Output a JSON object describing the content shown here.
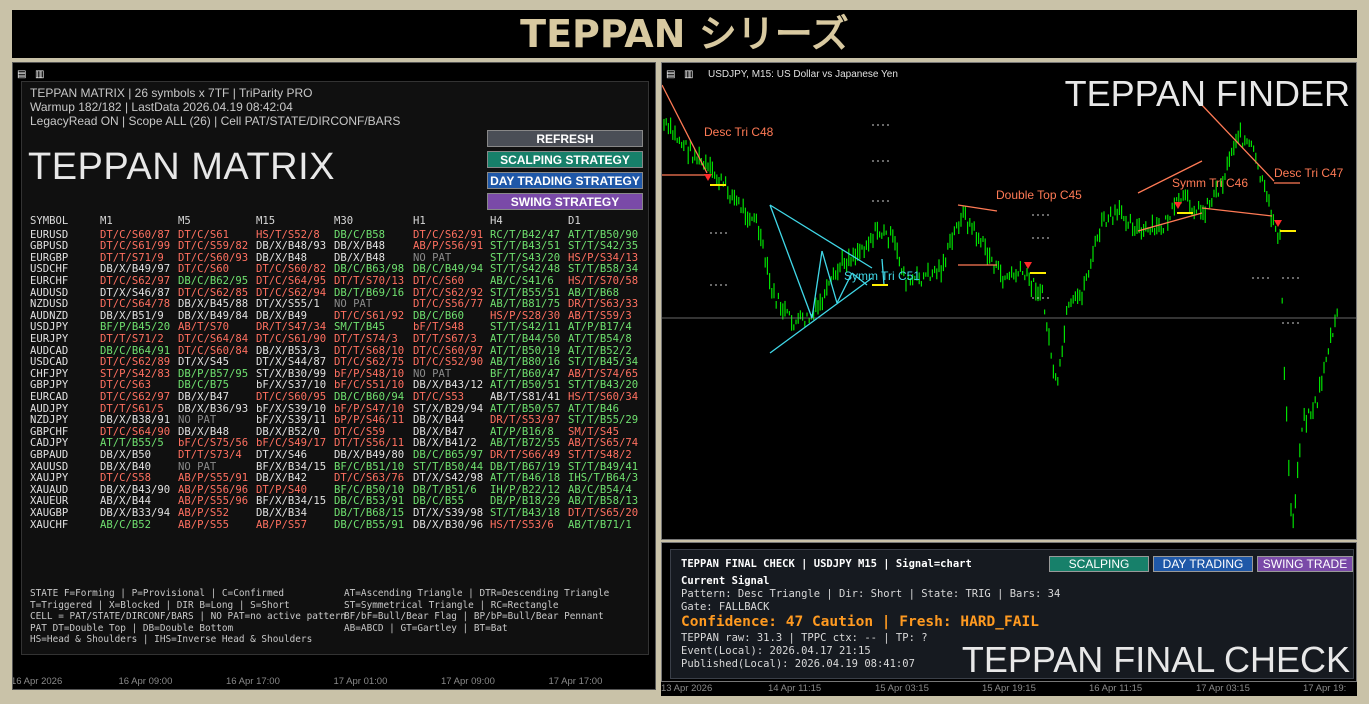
{
  "banner": "TEPPAN シリーズ",
  "matrix": {
    "header_lines": [
      "TEPPAN MATRIX | 26 symbols x 7TF | TriParity PRO",
      "Warmup 182/182 | LastData 2026.04.19 08:42:04",
      "LegacyRead ON | Scope ALL (26) | Cell PAT/STATE/DIRCONF/BARS"
    ],
    "big_title": "TEPPAN MATRIX",
    "buttons": {
      "refresh": "REFRESH",
      "scalping": "SCALPING STRATEGY",
      "day": "DAY TRADING STRATEGY",
      "swing": "SWING STRATEGY"
    },
    "columns": [
      "SYMBOL",
      "M1",
      "M5",
      "M15",
      "M30",
      "H1",
      "H4",
      "D1"
    ],
    "rows": [
      [
        "EURUSD",
        "DT/C/S60/87",
        "DT/C/S61",
        "HS/T/S52/8",
        "DB/C/B58",
        "DT/C/S62/91",
        "RC/T/B42/47",
        "AT/T/B50/90"
      ],
      [
        "GBPUSD",
        "DT/C/S61/99",
        "DT/C/S59/82",
        "DB/X/B48/93",
        "DB/X/B48",
        "AB/P/S56/91",
        "ST/T/B43/51",
        "ST/T/S42/35"
      ],
      [
        "EURGBP",
        "DT/T/S71/9",
        "DT/C/S60/93",
        "DB/X/B48",
        "DB/X/B48",
        "NO PAT",
        "ST/T/S43/20",
        "HS/P/S34/13"
      ],
      [
        "USDCHF",
        "DB/X/B49/97",
        "DT/C/S60",
        "DT/C/S60/82",
        "DB/C/B63/98",
        "DB/C/B49/94",
        "ST/T/S42/48",
        "ST/T/B58/34"
      ],
      [
        "EURCHF",
        "DT/C/S62/97",
        "DB/C/B62/95",
        "DT/C/S64/95",
        "DT/T/S70/13",
        "DT/C/S60",
        "AB/C/S41/6",
        "HS/T/S70/58"
      ],
      [
        "AUDUSD",
        "DT/X/S46/87",
        "DT/C/S62/85",
        "DT/C/S62/94",
        "DB/T/B69/16",
        "DT/C/S62/92",
        "ST/T/B55/51",
        "AB/T/B68"
      ],
      [
        "NZDUSD",
        "DT/C/S64/78",
        "DB/X/B45/88",
        "DT/X/S55/1",
        "NO PAT",
        "DT/C/S56/77",
        "AB/T/B81/75",
        "DR/T/S63/33"
      ],
      [
        "AUDNZD",
        "DB/X/B51/9",
        "DB/X/B49/84",
        "DB/X/B49",
        "DT/C/S61/92",
        "DB/C/B60",
        "HS/P/S28/30",
        "AB/T/S59/3"
      ],
      [
        "USDJPY",
        "BF/P/B45/20",
        "AB/T/S70",
        "DR/T/S47/34",
        "SM/T/B45",
        "bF/T/S48",
        "ST/T/S42/11",
        "AT/P/B17/4"
      ],
      [
        "EURJPY",
        "DT/T/S71/2",
        "DT/C/S64/84",
        "DT/C/S61/90",
        "DT/T/S74/3",
        "DT/T/S67/3",
        "AT/T/B44/50",
        "AT/T/B54/8"
      ],
      [
        "AUDCAD",
        "DB/C/B64/91",
        "DT/C/S60/84",
        "DB/X/B53/3",
        "DT/T/S68/10",
        "DT/C/S60/97",
        "AT/T/B50/19",
        "AT/T/B52/2"
      ],
      [
        "USDCAD",
        "DT/C/S62/89",
        "DT/X/S45",
        "DT/X/S44/87",
        "DT/C/S62/75",
        "DT/C/S52/90",
        "AB/T/B80/16",
        "ST/T/B45/34"
      ],
      [
        "CHFJPY",
        "ST/P/S42/83",
        "DB/P/B57/95",
        "ST/X/B30/99",
        "bF/P/S48/10",
        "NO PAT",
        "BF/T/B60/47",
        "AB/T/S74/65"
      ],
      [
        "GBPJPY",
        "DT/C/S63",
        "DB/C/B75",
        "bF/X/S37/10",
        "bF/C/S51/10",
        "DB/X/B43/12",
        "AT/T/B50/51",
        "ST/T/B43/20"
      ],
      [
        "EURCAD",
        "DT/C/S62/97",
        "DB/X/B47",
        "DT/C/S60/95",
        "DB/C/B60/94",
        "DT/C/S53",
        "AB/T/S81/41",
        "HS/T/S60/34"
      ],
      [
        "AUDJPY",
        "DT/T/S61/5",
        "DB/X/B36/93",
        "bF/X/S39/10",
        "bF/P/S47/10",
        "ST/X/B29/94",
        "AT/T/B50/57",
        "AT/T/B46"
      ],
      [
        "NZDJPY",
        "DB/X/B38/91",
        "NO PAT",
        "bF/X/S39/11",
        "bP/P/S46/11",
        "DB/X/B44",
        "DR/T/S53/97",
        "ST/T/B55/29"
      ],
      [
        "GBPCHF",
        "DT/C/S64/90",
        "DB/X/B48",
        "DB/X/B52/0",
        "DT/C/S59",
        "DB/X/B47",
        "AT/P/B16/8",
        "SM/T/S45"
      ],
      [
        "CADJPY",
        "AT/T/B55/5",
        "bF/C/S75/56",
        "bF/C/S49/17",
        "DT/T/S56/11",
        "DB/X/B41/2",
        "AB/T/B72/55",
        "AB/T/S65/74"
      ],
      [
        "GBPAUD",
        "DB/X/B50",
        "DT/T/S73/4",
        "DT/X/S46",
        "DB/X/B49/80",
        "DB/C/B65/97",
        "DR/T/S66/49",
        "ST/T/S48/2"
      ],
      [
        "XAUUSD",
        "DB/X/B40",
        "NO PAT",
        "BF/X/B34/15",
        "BF/C/B51/10",
        "ST/T/B50/44",
        "DB/T/B67/19",
        "ST/T/B49/41"
      ],
      [
        "XAUJPY",
        "DT/C/S58",
        "AB/P/S55/91",
        "DB/X/B42",
        "DT/C/S63/76",
        "DT/X/S42/98",
        "AT/T/B46/18",
        "IHS/T/B64/3"
      ],
      [
        "XAUAUD",
        "DB/X/B43/90",
        "AB/P/S56/96",
        "DT/P/S40",
        "BF/C/B50/10",
        "DB/T/B51/6",
        "IH/P/B22/12",
        "AB/C/B54/4"
      ],
      [
        "XAUEUR",
        "AB/X/B44",
        "AB/P/S55/96",
        "BF/X/B34/15",
        "DB/C/B53/91",
        "DB/C/B55",
        "DB/P/B18/29",
        "AB/T/B58/13"
      ],
      [
        "XAUGBP",
        "DB/X/B33/94",
        "AB/P/S52",
        "DB/X/B34",
        "DB/T/B68/15",
        "DT/X/S39/98",
        "ST/T/B43/18",
        "DT/T/S65/20"
      ],
      [
        "XAUCHF",
        "AB/C/B52",
        "AB/P/S55",
        "AB/P/S57",
        "DB/C/B55/91",
        "DB/X/B30/96",
        "HS/T/S53/6",
        "AB/T/B71/1"
      ]
    ],
    "colors": [
      [
        "w",
        "r",
        "r",
        "r",
        "g",
        "r",
        "g",
        "g"
      ],
      [
        "w",
        "r",
        "r",
        "w",
        "w",
        "r",
        "g",
        "g"
      ],
      [
        "w",
        "r",
        "r",
        "w",
        "w",
        "gr",
        "g",
        "r"
      ],
      [
        "w",
        "w",
        "r",
        "r",
        "g",
        "g",
        "g",
        "g"
      ],
      [
        "w",
        "r",
        "g",
        "r",
        "r",
        "r",
        "g",
        "r"
      ],
      [
        "w",
        "w",
        "r",
        "r",
        "g",
        "r",
        "g",
        "g"
      ],
      [
        "w",
        "r",
        "w",
        "w",
        "gr",
        "r",
        "g",
        "r"
      ],
      [
        "w",
        "w",
        "w",
        "w",
        "r",
        "g",
        "r",
        "r"
      ],
      [
        "w",
        "g",
        "r",
        "r",
        "g",
        "r",
        "g",
        "g"
      ],
      [
        "w",
        "r",
        "r",
        "r",
        "r",
        "r",
        "g",
        "g"
      ],
      [
        "w",
        "g",
        "r",
        "w",
        "r",
        "r",
        "g",
        "g"
      ],
      [
        "w",
        "r",
        "w",
        "w",
        "r",
        "r",
        "g",
        "g"
      ],
      [
        "w",
        "r",
        "g",
        "w",
        "r",
        "gr",
        "g",
        "r"
      ],
      [
        "w",
        "r",
        "g",
        "w",
        "r",
        "w",
        "g",
        "g"
      ],
      [
        "w",
        "r",
        "w",
        "r",
        "g",
        "r",
        "w",
        "r"
      ],
      [
        "w",
        "r",
        "w",
        "w",
        "r",
        "w",
        "g",
        "g"
      ],
      [
        "w",
        "w",
        "gr",
        "w",
        "r",
        "w",
        "r",
        "g"
      ],
      [
        "w",
        "r",
        "w",
        "w",
        "r",
        "w",
        "g",
        "r"
      ],
      [
        "w",
        "g",
        "r",
        "r",
        "r",
        "w",
        "g",
        "r"
      ],
      [
        "w",
        "w",
        "r",
        "w",
        "w",
        "g",
        "r",
        "r"
      ],
      [
        "w",
        "w",
        "gr",
        "w",
        "g",
        "g",
        "g",
        "g"
      ],
      [
        "w",
        "r",
        "r",
        "w",
        "r",
        "w",
        "g",
        "g"
      ],
      [
        "w",
        "w",
        "r",
        "r",
        "g",
        "g",
        "g",
        "g"
      ],
      [
        "w",
        "w",
        "r",
        "w",
        "g",
        "g",
        "g",
        "g"
      ],
      [
        "w",
        "w",
        "r",
        "w",
        "g",
        "w",
        "g",
        "r"
      ],
      [
        "w",
        "g",
        "r",
        "r",
        "g",
        "w",
        "r",
        "g"
      ]
    ],
    "legend_left": [
      "STATE F=Forming | P=Provisional | C=Confirmed",
      "T=Triggered | X=Blocked | DIR B=Long | S=Short",
      "CELL = PAT/STATE/DIRCONF/BARS | NO PAT=no active pattern",
      "PAT DT=Double Top | DB=Double Bottom",
      "HS=Head & Shoulders | IHS=Inverse Head & Shoulders"
    ],
    "legend_right": [
      "AT=Ascending Triangle | DTR=Descending Triangle",
      "ST=Symmetrical Triangle | RC=Rectangle",
      "BF/bF=Bull/Bear Flag | BP/bP=Bull/Bear Pennant",
      "AB=ABCD | GT=Gartley | BT=Bat"
    ],
    "xaxis": [
      "16 Apr 2026",
      "16 Apr 09:00",
      "16 Apr 17:00",
      "17 Apr 01:00",
      "17 Apr 09:00",
      "17 Apr 17:00"
    ]
  },
  "finder": {
    "window_title": "USDJPY, M15:  US Dollar vs Japanese Yen",
    "big_title": "TEPPAN FINDER",
    "annotations": [
      "Desc Tri C48",
      "Double Top C45",
      "Symm Tri C46",
      "Desc Tri C47",
      "Symm Tri C51"
    ],
    "xaxis": [
      "13 Apr 2026",
      "14 Apr 11:15",
      "15 Apr 03:15",
      "15 Apr 19:15",
      "16 Apr 11:15",
      "17 Apr 03:15",
      "17 Apr 19:"
    ],
    "colors": {
      "bull": "#00e000",
      "pattern_red": "#ff7a55",
      "pattern_cyan": "#40d8e8",
      "marker_yellow": "#ffee00"
    }
  },
  "final_check": {
    "title_line": "TEPPAN FINAL CHECK | USDJPY M15 | Signal=chart",
    "buttons": {
      "scalping": "SCALPING",
      "day": "DAY TRADING",
      "swing": "SWING TRADE"
    },
    "current_signal": "Current Signal",
    "pattern_line": "Pattern: Desc Triangle | Dir: Short | State: TRIG | Bars: 34",
    "gate_line": "Gate: FALLBACK",
    "confidence_line": "Confidence: 47 Caution | Fresh: HARD_FAIL",
    "raw_line": "TEPPAN raw: 31.3 | TPPC ctx: -- | TP: ?",
    "event_line": "Event(Local): 2026.04.17 21:15",
    "published_line": "Published(Local): 2026.04.19 08:41:07",
    "big_title": "TEPPAN FINAL CHECK"
  }
}
